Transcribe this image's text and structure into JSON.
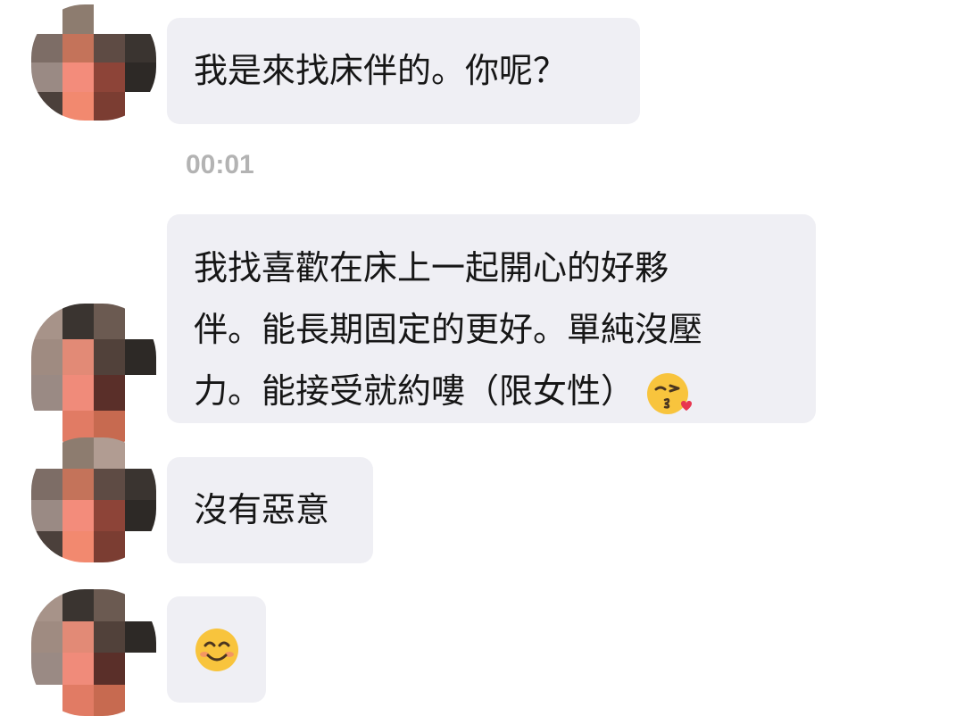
{
  "messages": [
    {
      "lines": [
        "我是來找床伴的。你呢？"
      ]
    },
    {
      "lines": [
        "我找喜歡在床上一起開心的好夥",
        "伴。能長期固定的更好。單純沒壓",
        "力。能接受就約嘍（限女性）"
      ],
      "trailing_emoji": "face-blowing-kiss-icon"
    },
    {
      "lines": [
        "沒有惡意"
      ]
    },
    {
      "lines": [],
      "emoji": "smiling-face-icon"
    }
  ],
  "timestamp": "00:01",
  "colors": {
    "bubble": "#efeff4",
    "text": "#161616",
    "timestamp": "#b3b3b3"
  }
}
